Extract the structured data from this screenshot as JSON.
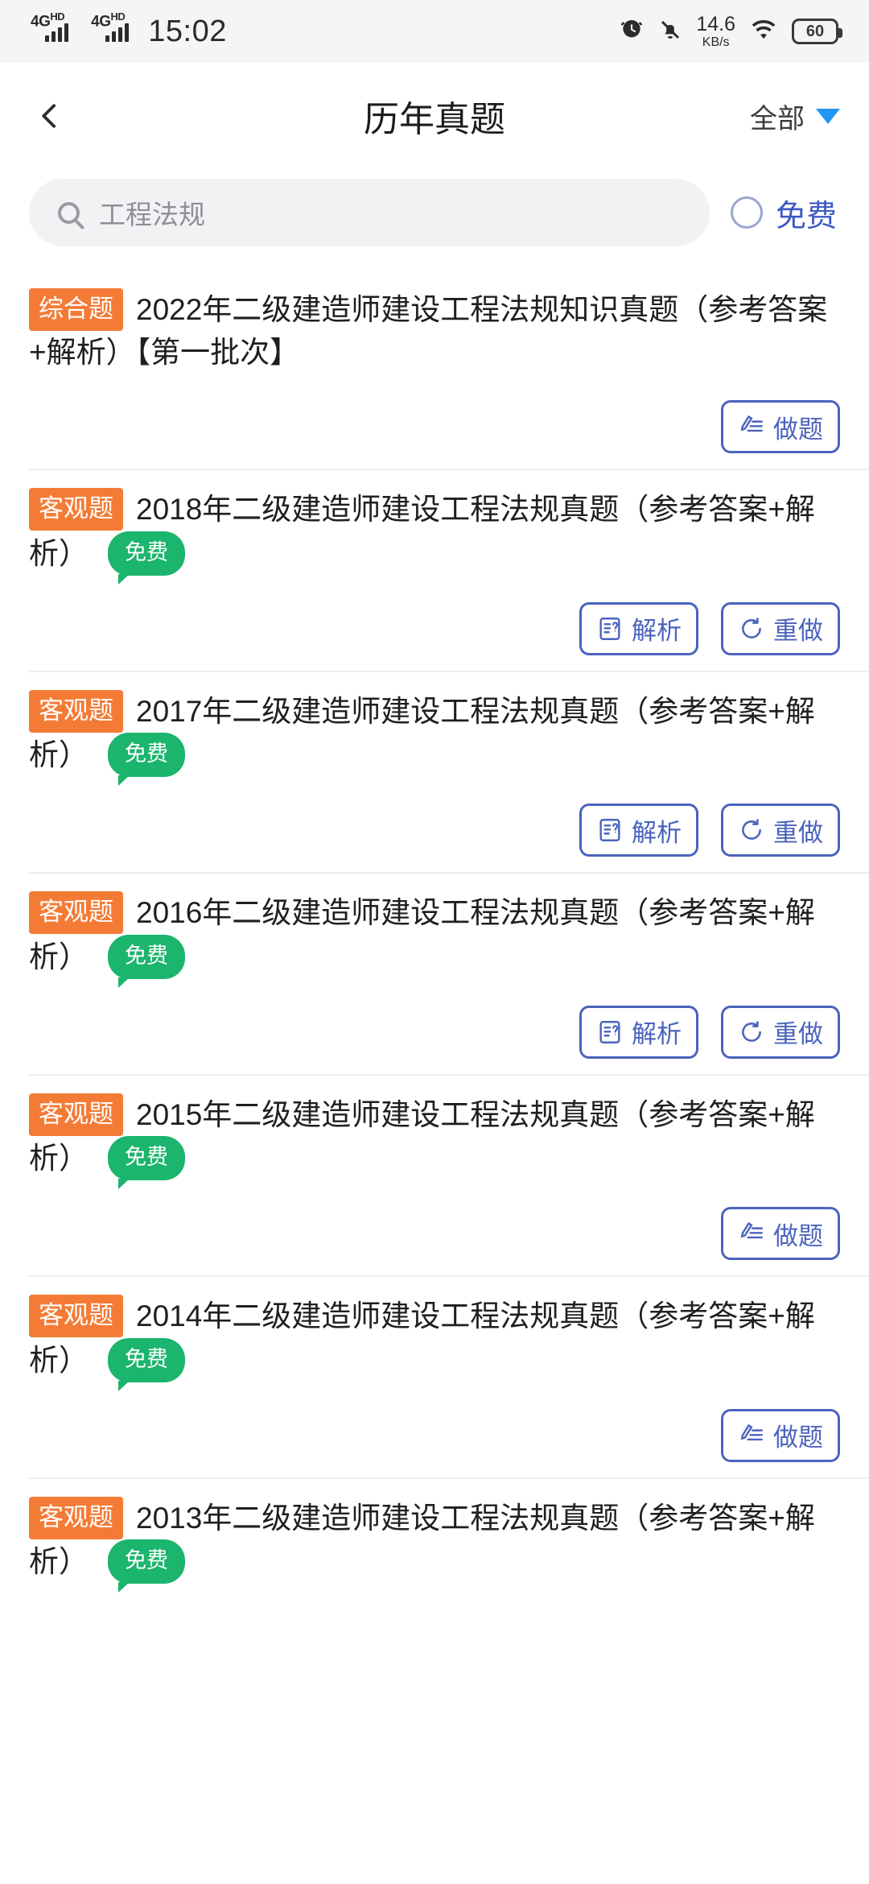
{
  "status_bar": {
    "network_label": "4G",
    "network_sup": "HD",
    "time": "15:02",
    "net_speed_value": "14.6",
    "net_speed_unit": "KB/s",
    "battery": "60",
    "icons": [
      "signal-icon",
      "signal-icon",
      "alarm-icon",
      "mute-icon",
      "wifi-icon",
      "battery-icon"
    ]
  },
  "header": {
    "back_icon": "chevron-left-icon",
    "title": "历年真题",
    "filter_label": "全部",
    "filter_icon": "triangle-down-icon"
  },
  "search": {
    "icon": "search-icon",
    "placeholder": "工程法规",
    "value": "",
    "free_filter_label": "免费",
    "free_filter_checked": false
  },
  "labels": {
    "tag_comprehensive": "综合题",
    "tag_objective": "客观题",
    "badge_free": "免费",
    "btn_do": "做题",
    "btn_analysis": "解析",
    "btn_redo": "重做"
  },
  "colors": {
    "tag_orange": "#f47b36",
    "badge_green": "#1bb56d",
    "button_blue": "#4a63bd",
    "link_blue": "#3d5ac2",
    "triangle_blue": "#2196f3"
  },
  "items": [
    {
      "tag": "综合题",
      "title": "2022年二级建造师建设工程法规知识真题（参考答案+解析）【第一批次】",
      "free": false,
      "buttons": [
        "做题"
      ]
    },
    {
      "tag": "客观题",
      "title": "2018年二级建造师建设工程法规真题（参考答案+解析）",
      "free": true,
      "free_label": "免费",
      "buttons": [
        "解析",
        "重做"
      ]
    },
    {
      "tag": "客观题",
      "title": "2017年二级建造师建设工程法规真题（参考答案+解析）",
      "free": true,
      "free_label": "免费",
      "buttons": [
        "解析",
        "重做"
      ]
    },
    {
      "tag": "客观题",
      "title": "2016年二级建造师建设工程法规真题（参考答案+解析）",
      "free": true,
      "free_label": "免费",
      "buttons": [
        "解析",
        "重做"
      ]
    },
    {
      "tag": "客观题",
      "title": "2015年二级建造师建设工程法规真题（参考答案+解析）",
      "free": true,
      "free_label": "免费",
      "buttons": [
        "做题"
      ]
    },
    {
      "tag": "客观题",
      "title": "2014年二级建造师建设工程法规真题（参考答案+解析）",
      "free": true,
      "free_label": "免费",
      "buttons": [
        "做题"
      ]
    },
    {
      "tag": "客观题",
      "title": "2013年二级建造师建设工程法规真题（参考答案+解析）",
      "free": true,
      "free_label": "免费",
      "buttons": []
    }
  ]
}
